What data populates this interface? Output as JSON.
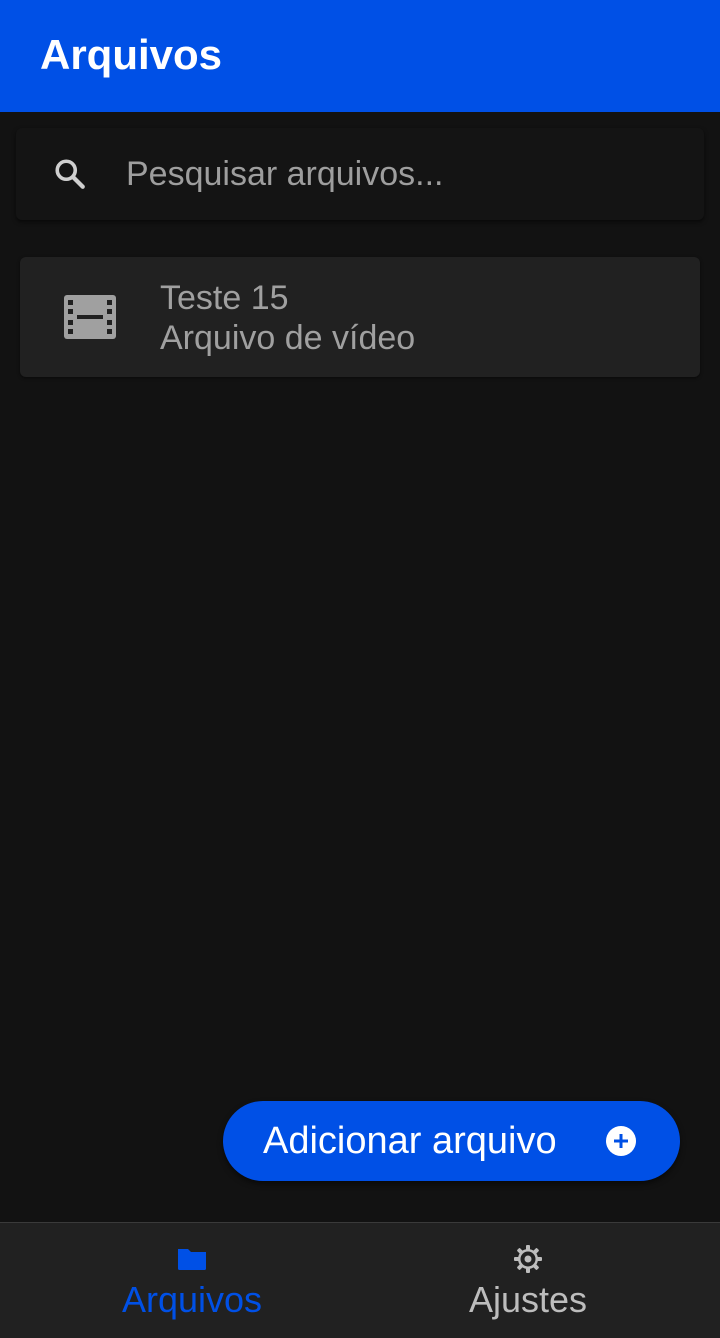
{
  "app_bar": {
    "title": "Arquivos"
  },
  "search": {
    "placeholder": "Pesquisar arquivos...",
    "value": ""
  },
  "files": [
    {
      "name": "Teste 15",
      "type": "Arquivo de vídeo",
      "icon": "film-icon"
    }
  ],
  "fab": {
    "label": "Adicionar arquivo",
    "icon": "add-circle-icon"
  },
  "bottom_nav": {
    "items": [
      {
        "label": "Arquivos",
        "icon": "folder-icon",
        "active": true
      },
      {
        "label": "Ajustes",
        "icon": "gear-icon",
        "active": false
      }
    ]
  },
  "colors": {
    "primary": "#0050e6",
    "background": "#121212",
    "surface": "#212121",
    "text_secondary": "#a0a0a0"
  }
}
